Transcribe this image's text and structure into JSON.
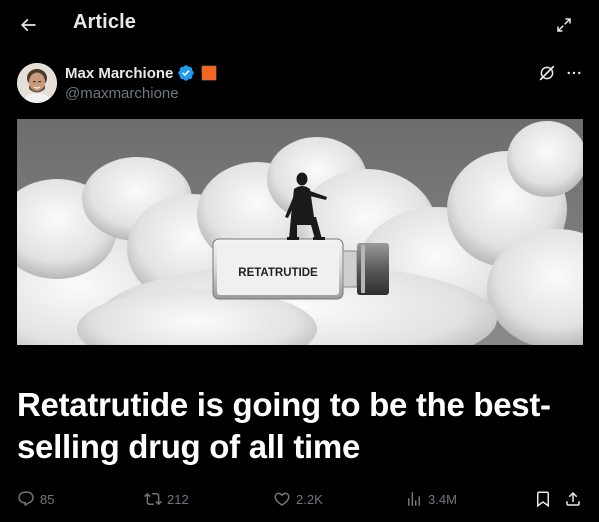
{
  "header": {
    "back_icon": "arrow-left-icon",
    "title": "Article",
    "expand_icon": "expand-arrows-icon"
  },
  "author": {
    "name": "Max Marchione",
    "handle": "@maxmarchione",
    "verified_color": "#1d9bf0",
    "affiliate_badge_color": "#f26522",
    "grok_icon": "grok-slash-icon",
    "more_icon": "more-horizontal-icon"
  },
  "hero": {
    "vial_label": "RETATRUTIDE"
  },
  "article": {
    "headline": "Retatrutide is going to be the best-selling drug of all time"
  },
  "actions": {
    "replies": "85",
    "reposts": "212",
    "likes": "2.2K",
    "views": "3.4M",
    "bookmark_icon": "bookmark-icon",
    "share_icon": "share-icon"
  },
  "colors": {
    "background": "#000000",
    "text": "#e7e9ea",
    "muted": "#71767b"
  }
}
